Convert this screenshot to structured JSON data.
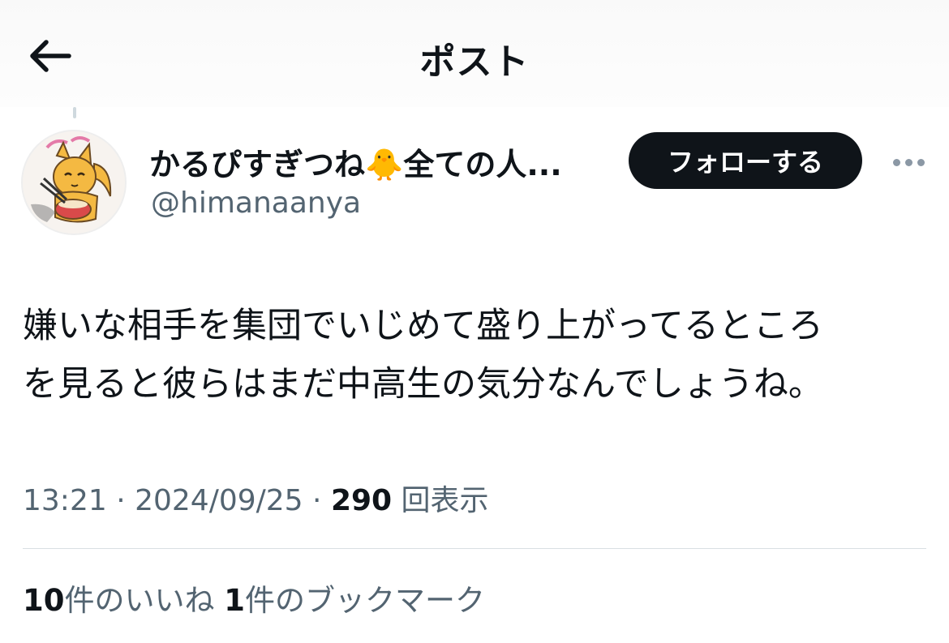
{
  "header": {
    "title": "ポスト"
  },
  "author": {
    "display_name": "かるぴすぎつね",
    "display_name_suffix": "全ての人...",
    "emoji": "🐥",
    "handle": "@himanaanya"
  },
  "follow_button": {
    "label": "フォローする"
  },
  "tweet": {
    "line1": "嫌いな相手を集団でいじめて盛り上がってるところ",
    "line2": "を見ると彼らはまだ中高生の気分なんでしょうね。"
  },
  "meta": {
    "time": "13:21",
    "date": "2024/09/25",
    "views_count": "290",
    "views_label": "回表示"
  },
  "stats": {
    "likes_count": "10",
    "likes_label": "件のいいね",
    "bookmarks_count": "1",
    "bookmarks_label": "件のブックマーク"
  },
  "colors": {
    "text": "#0f1419",
    "secondary": "#536471",
    "button_bg": "#0f1419"
  }
}
